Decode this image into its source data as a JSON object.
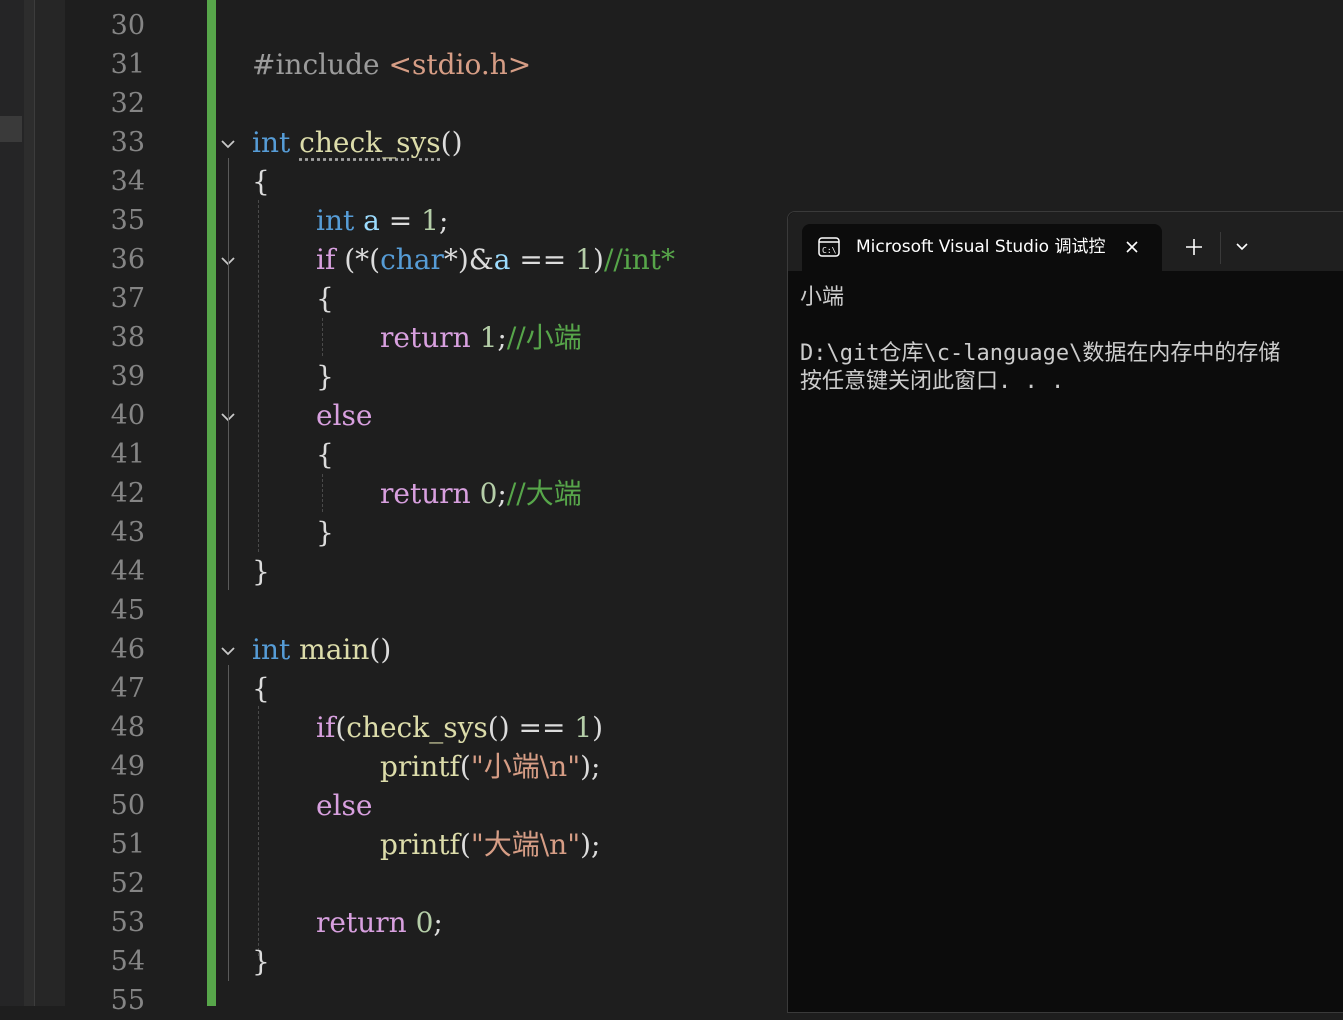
{
  "editor": {
    "line_numbers": [
      "30",
      "31",
      "32",
      "33",
      "34",
      "35",
      "36",
      "37",
      "38",
      "39",
      "40",
      "41",
      "42",
      "43",
      "44",
      "45",
      "46",
      "47",
      "48",
      "49",
      "50",
      "51",
      "52",
      "53",
      "54",
      "55"
    ],
    "code": {
      "l31_pp": "#include ",
      "l31_inc": "<stdio.h>",
      "l33_type": "int",
      "l33_fn": "check_sys",
      "l33_paren": "()",
      "l34": "{",
      "l35_type": "int",
      "l35_var": "a",
      "l35_eq": " = ",
      "l35_num": "1",
      "l35_end": ";",
      "l36_if": "if",
      "l36_a": " (*(",
      "l36_char": "char",
      "l36_b": "*)&",
      "l36_var": "a",
      "l36_c": " == ",
      "l36_num": "1",
      "l36_d": ")",
      "l36_cmt": "//int*",
      "l37": "{",
      "l38_ret": "return",
      "l38_num": " 1",
      "l38_end": ";",
      "l38_cmt": "//小端",
      "l39": "}",
      "l40_else": "else",
      "l41": "{",
      "l42_ret": "return",
      "l42_num": " 0",
      "l42_end": ";",
      "l42_cmt": "//大端",
      "l43": "}",
      "l44": "}",
      "l46_type": "int",
      "l46_fn": "main",
      "l46_paren": "()",
      "l47": "{",
      "l48_if": "if",
      "l48_a": "(",
      "l48_fn": "check_sys",
      "l48_b": "() == ",
      "l48_num": "1",
      "l48_c": ")",
      "l49_fn": "printf",
      "l49_a": "(",
      "l49_str": "\"小端\\n\"",
      "l49_b": ");",
      "l50_else": "else",
      "l51_fn": "printf",
      "l51_a": "(",
      "l51_str": "\"大端\\n\"",
      "l51_b": ");",
      "l53_ret": "return",
      "l53_num": " 0",
      "l53_end": ";",
      "l54": "}"
    }
  },
  "terminal": {
    "tab_title": "Microsoft Visual Studio 调试控",
    "output_line1": "小端",
    "output_line2": "D:\\git仓库\\c-language\\数据在内存中的存储",
    "output_line3": "按任意键关闭此窗口. . ."
  },
  "colors": {
    "editor_bg": "#1e1e1e",
    "keyword": "#569cd6",
    "control_keyword": "#d8a0df",
    "function": "#dcdcaa",
    "variable": "#9cdcfe",
    "number": "#b5cea8",
    "string": "#d69d85",
    "comment": "#57a64a",
    "change_bar": "#57a64a",
    "terminal_bg": "#0c0c0c"
  }
}
